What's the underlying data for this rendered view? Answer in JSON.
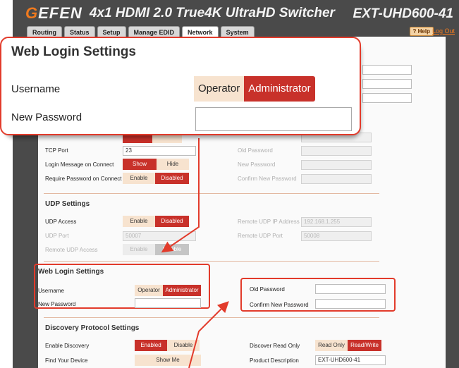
{
  "header": {
    "logo": "GEFEN",
    "logo_initial": "G",
    "logo_rest": "EFEN",
    "product": "4x1 HDMI 2.0 True4K UltraHD Switcher",
    "model": "EXT-UHD600-41",
    "help": "? Help",
    "logout": "Log Out"
  },
  "tabs": [
    {
      "label": "Routing"
    },
    {
      "label": "Status"
    },
    {
      "label": "Setup"
    },
    {
      "label": "Manage EDID"
    },
    {
      "label": "Network",
      "active": true
    },
    {
      "label": "System"
    }
  ],
  "telnet": {
    "tcp_port_label": "TCP Port",
    "tcp_port_value": "23",
    "login_msg_label": "Login Message on Connect",
    "login_msg_opts": [
      "Show",
      "Hide"
    ],
    "require_pw_label": "Require Password on Connect",
    "require_pw_opts": [
      "Enable",
      "Disabled"
    ],
    "old_password_label": "Old Password",
    "new_password_label": "New Password",
    "confirm_password_label": "Confirm New Password"
  },
  "udp": {
    "title": "UDP Settings",
    "access_label": "UDP Access",
    "access_opts": [
      "Enable",
      "Disabled"
    ],
    "port_label": "UDP Port",
    "port_value": "50007",
    "remote_access_label": "Remote UDP Access",
    "remote_access_opts": [
      "Enable",
      "Disable"
    ],
    "remote_ip_label": "Remote UDP IP Address",
    "remote_ip_value": "192.168.1.255",
    "remote_port_label": "Remote UDP Port",
    "remote_port_value": "50008"
  },
  "web_login": {
    "title": "Web Login Settings",
    "username_label": "Username",
    "username_opts": [
      "Operator",
      "Administrator"
    ],
    "new_password_label": "New Password",
    "old_password_label": "Old Password",
    "confirm_password_label": "Confirm New Password"
  },
  "discovery": {
    "title": "Discovery Protocol Settings",
    "enable_label": "Enable Discovery",
    "enable_opts": [
      "Enabled",
      "Disable"
    ],
    "find_label": "Find Your Device",
    "find_button": "Show Me",
    "read_only_label": "Discover Read Only",
    "read_only_opts": [
      "Read Only",
      "Read/Write"
    ],
    "product_desc_label": "Product Description",
    "product_desc_value": "EXT-UHD600-41"
  },
  "zoom": {
    "title": "Web Login Settings",
    "username_label": "Username",
    "opts": [
      "Operator",
      "Administrator"
    ],
    "new_password_label": "New Password"
  },
  "colors": {
    "accent_active": "#c8312a",
    "accent_inactive": "#f7e3cf",
    "highlight_border": "#e23b2b",
    "brand_orange": "#f07a1e",
    "header_bg": "#4a4a4a"
  }
}
